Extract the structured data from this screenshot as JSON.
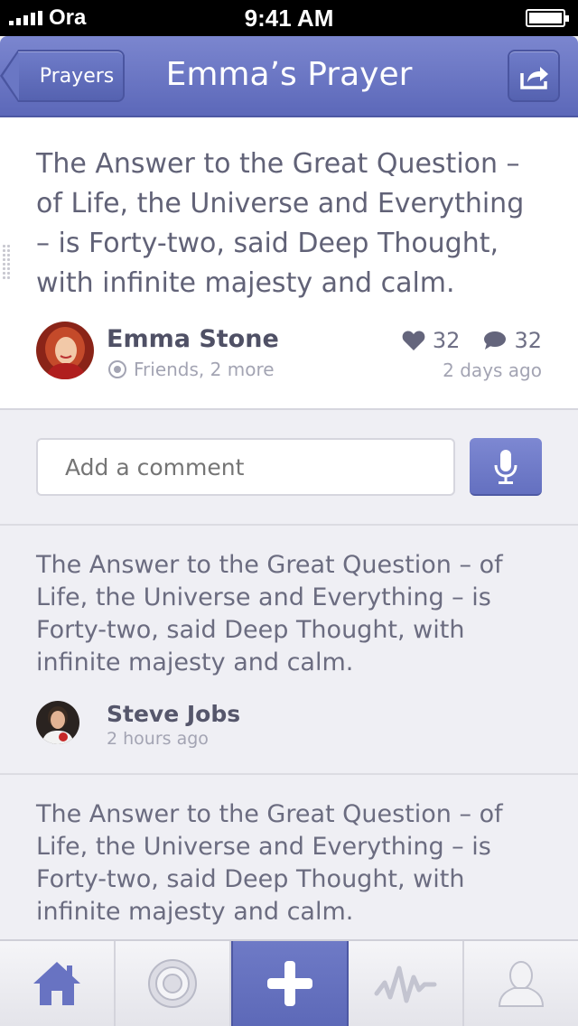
{
  "status_bar": {
    "carrier": "Ora",
    "time": "9:41 AM"
  },
  "nav": {
    "back_label": "Prayers",
    "title": "Emma’s Prayer",
    "share_icon": "share-icon"
  },
  "post": {
    "text": "The Answer to the Great Question – of Life, the Universe and Everything – is Forty-two, said Deep Thought, with infinite majesty and calm.",
    "author": "Emma Stone",
    "audience": "Friends, 2 more",
    "likes": "32",
    "comments": "32",
    "time": "2 days ago"
  },
  "comment_box": {
    "placeholder": "Add a comment"
  },
  "comments": [
    {
      "text": "The Answer to the Great Question – of Life, the Universe and Everything – is Forty-two, said Deep Thought, with infinite majesty and calm.",
      "author": "Steve Jobs",
      "time": "2 hours ago"
    },
    {
      "text": "The Answer to the Great Question – of Life, the Universe and Everything – is Forty-two, said Deep Thought, with infinite majesty and calm."
    }
  ],
  "tabs": [
    {
      "name": "home",
      "icon": "home-icon"
    },
    {
      "name": "target",
      "icon": "target-icon"
    },
    {
      "name": "add",
      "icon": "plus-icon",
      "active": true
    },
    {
      "name": "activity",
      "icon": "pulse-icon"
    },
    {
      "name": "profile",
      "icon": "person-icon"
    }
  ],
  "colors": {
    "accent": "#6470c0",
    "text": "#616277",
    "muted": "#a3a4b3"
  }
}
